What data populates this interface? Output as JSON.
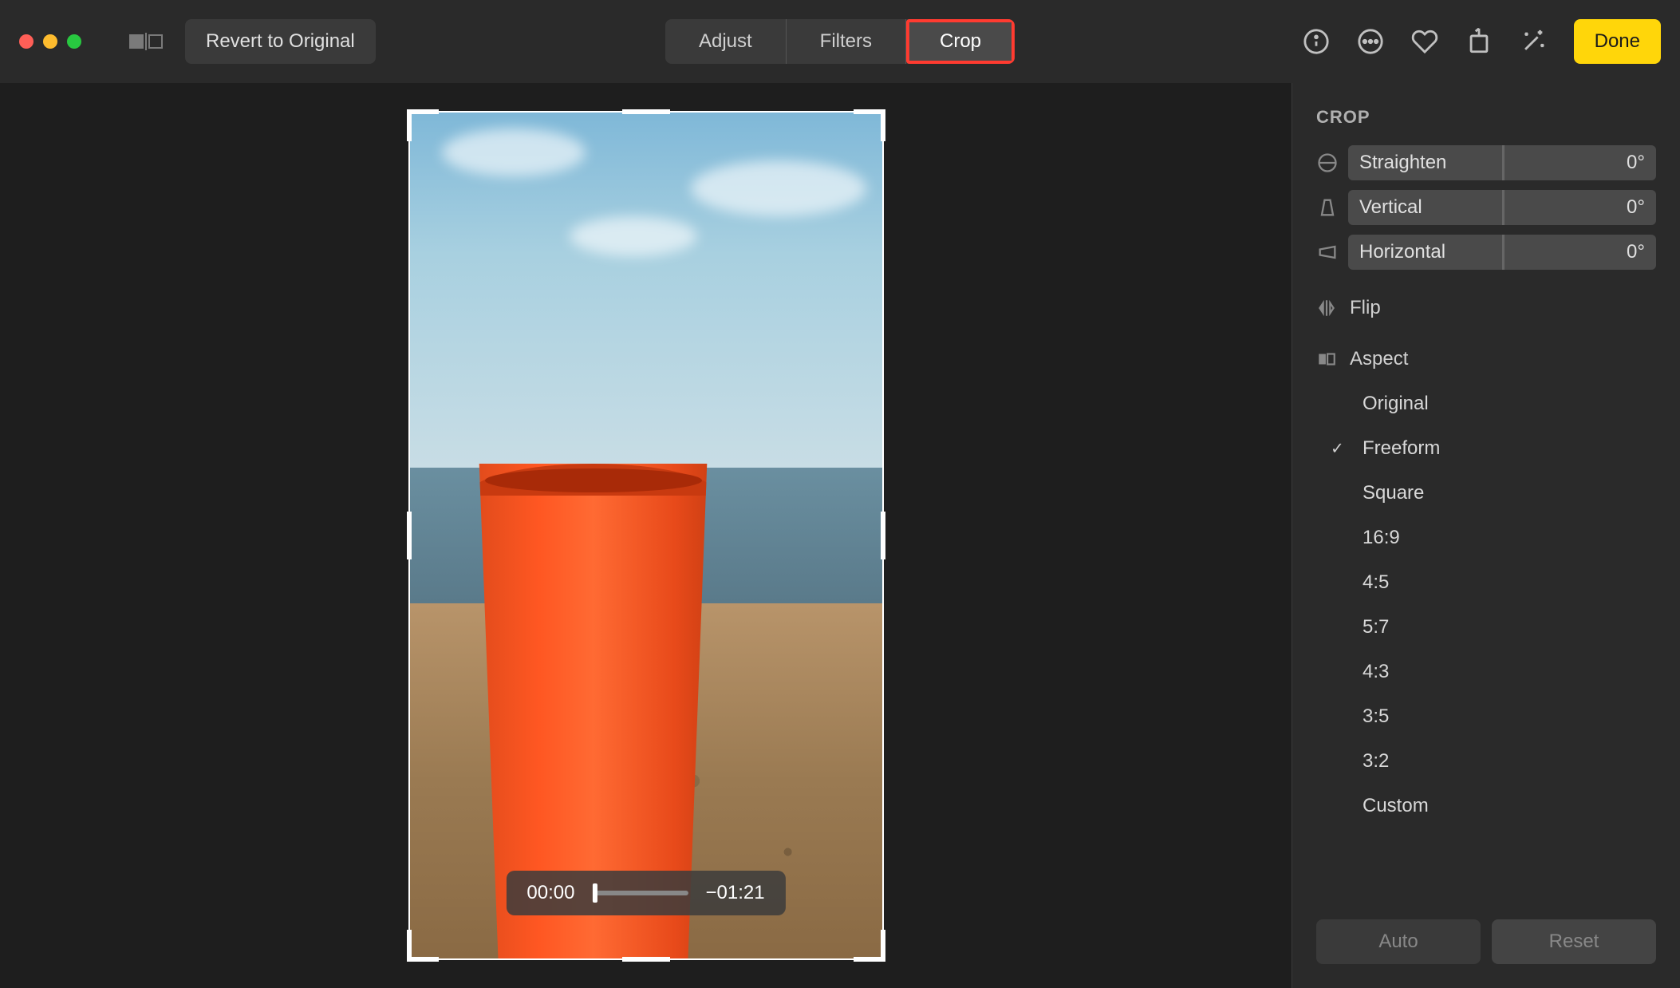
{
  "titlebar": {
    "revert_label": "Revert to Original",
    "done_label": "Done",
    "tabs": {
      "adjust": "Adjust",
      "filters": "Filters",
      "crop": "Crop"
    }
  },
  "scrubber": {
    "current": "00:00",
    "remaining": "−01:21"
  },
  "sidebar": {
    "title": "CROP",
    "adjustments": {
      "straighten": {
        "label": "Straighten",
        "value": "0°"
      },
      "vertical": {
        "label": "Vertical",
        "value": "0°"
      },
      "horizontal": {
        "label": "Horizontal",
        "value": "0°"
      }
    },
    "flip_label": "Flip",
    "aspect_label": "Aspect",
    "aspect_items": [
      {
        "label": "Original",
        "checked": false
      },
      {
        "label": "Freeform",
        "checked": true
      },
      {
        "label": "Square",
        "checked": false
      },
      {
        "label": "16:9",
        "checked": false
      },
      {
        "label": "4:5",
        "checked": false
      },
      {
        "label": "5:7",
        "checked": false
      },
      {
        "label": "4:3",
        "checked": false
      },
      {
        "label": "3:5",
        "checked": false
      },
      {
        "label": "3:2",
        "checked": false
      },
      {
        "label": "Custom",
        "checked": false
      }
    ],
    "footer": {
      "auto": "Auto",
      "reset": "Reset"
    }
  }
}
